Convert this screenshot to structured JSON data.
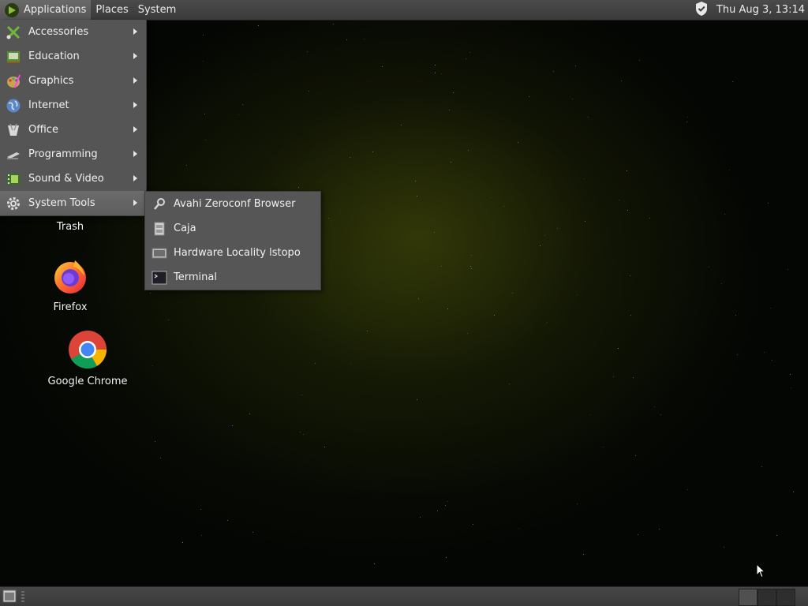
{
  "top_panel": {
    "menus": [
      "Applications",
      "Places",
      "System"
    ],
    "clock": "Thu Aug  3, 13:14",
    "tray_icon": "shield-icon"
  },
  "app_menu": {
    "items": [
      {
        "label": "Accessories",
        "icon": "accessories-icon"
      },
      {
        "label": "Education",
        "icon": "education-icon"
      },
      {
        "label": "Graphics",
        "icon": "graphics-icon"
      },
      {
        "label": "Internet",
        "icon": "globe-icon"
      },
      {
        "label": "Office",
        "icon": "office-icon"
      },
      {
        "label": "Programming",
        "icon": "programming-icon"
      },
      {
        "label": "Sound & Video",
        "icon": "film-icon"
      },
      {
        "label": "System Tools",
        "icon": "gear-icon"
      }
    ],
    "active_item": "System Tools"
  },
  "system_tools_menu": {
    "items": [
      {
        "label": "Avahi Zeroconf Browser",
        "icon": "network-search-icon"
      },
      {
        "label": "Caja",
        "icon": "file-cabinet-icon"
      },
      {
        "label": "Hardware Locality lstopo",
        "icon": "hardware-icon"
      },
      {
        "label": "Terminal",
        "icon": "terminal-icon"
      }
    ]
  },
  "desktop": {
    "icons": [
      {
        "label": "Trash"
      },
      {
        "label": "Firefox"
      },
      {
        "label": "Google Chrome"
      }
    ]
  },
  "colors": {
    "panel": "#3f3f3f",
    "menu_bg": "#555555",
    "menu_hover": "#666666"
  }
}
